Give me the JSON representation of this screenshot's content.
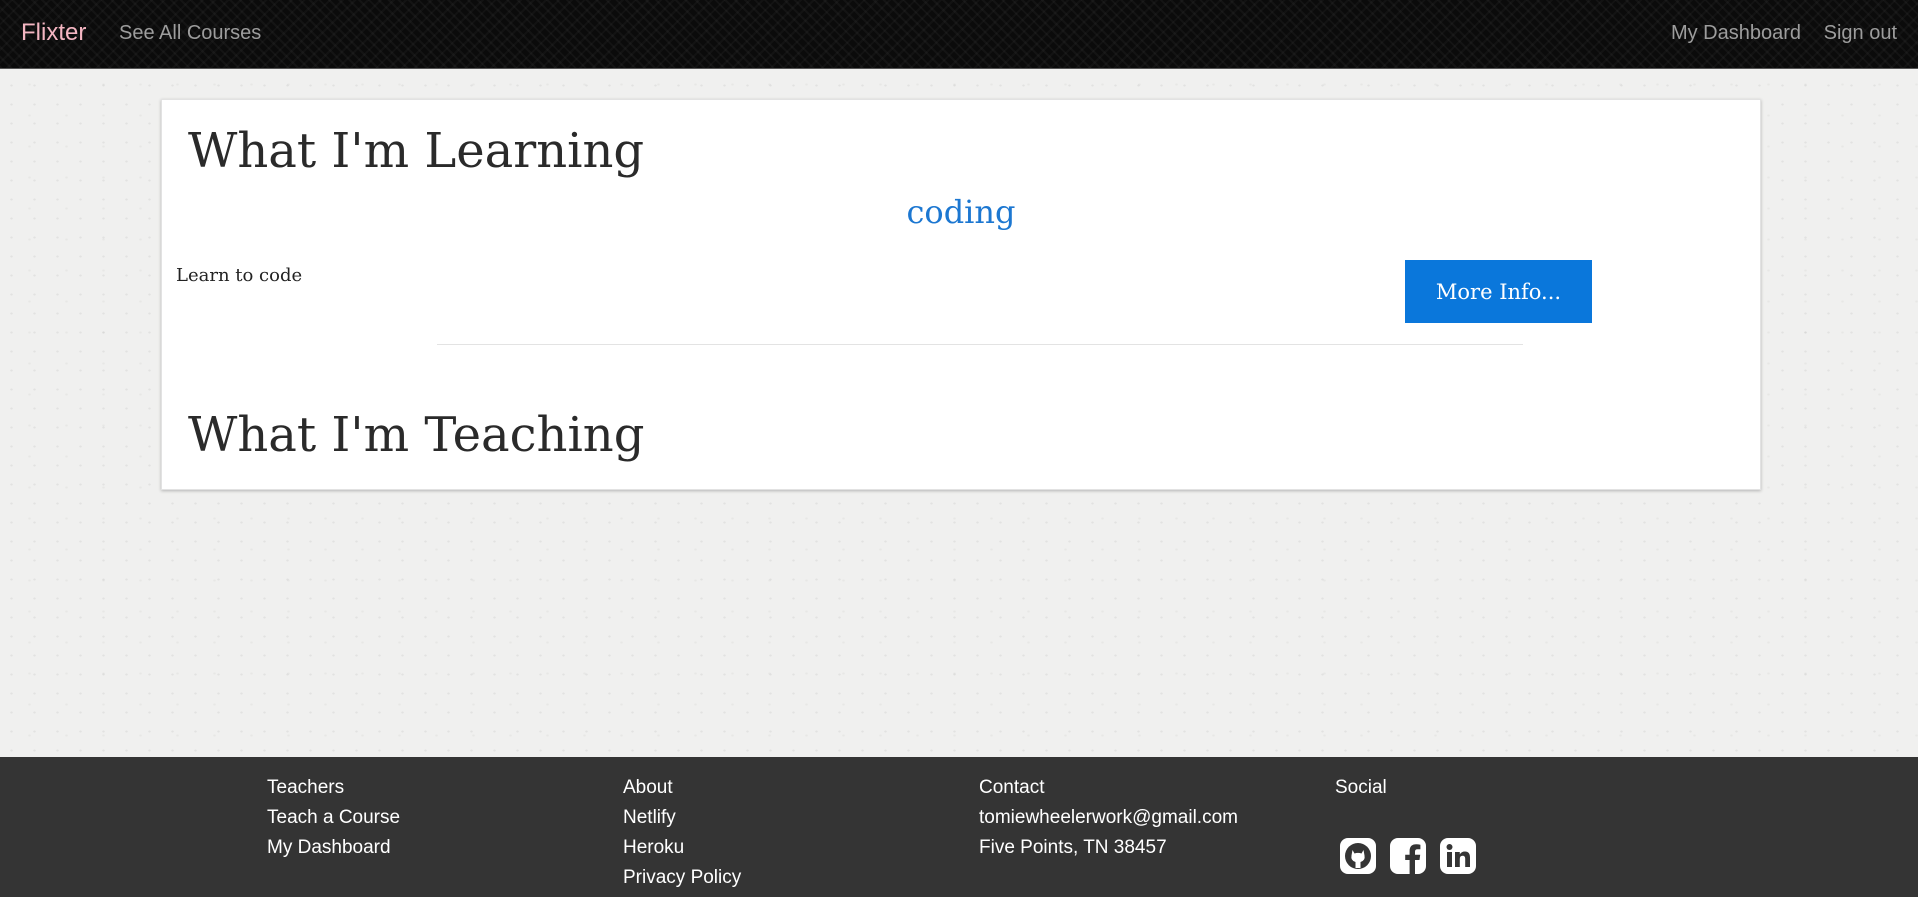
{
  "navbar": {
    "brand": "Flixter",
    "all_courses": "See All Courses",
    "dashboard": "My Dashboard",
    "sign_out": "Sign out",
    "brand_color": "#f4b6c2"
  },
  "main": {
    "learning_title": "What I'm Learning",
    "teaching_title": "What I'm Teaching",
    "courses": [
      {
        "title": "coding",
        "description": "Learn to code",
        "button_label": "More Info..."
      }
    ],
    "accent_color": "#0a77db"
  },
  "footer": {
    "teachers": {
      "heading": "Teachers",
      "links": [
        "Teach a Course",
        "My Dashboard"
      ]
    },
    "about": {
      "heading": "About",
      "links": [
        "Netlify",
        "Heroku",
        "Privacy Policy"
      ]
    },
    "contact": {
      "heading": "Contact",
      "email": "tomiewheelerwork@gmail.com",
      "address": "Five Points, TN 38457"
    },
    "social": {
      "heading": "Social",
      "icons": [
        "github-icon",
        "facebook-icon",
        "linkedin-icon"
      ]
    }
  }
}
